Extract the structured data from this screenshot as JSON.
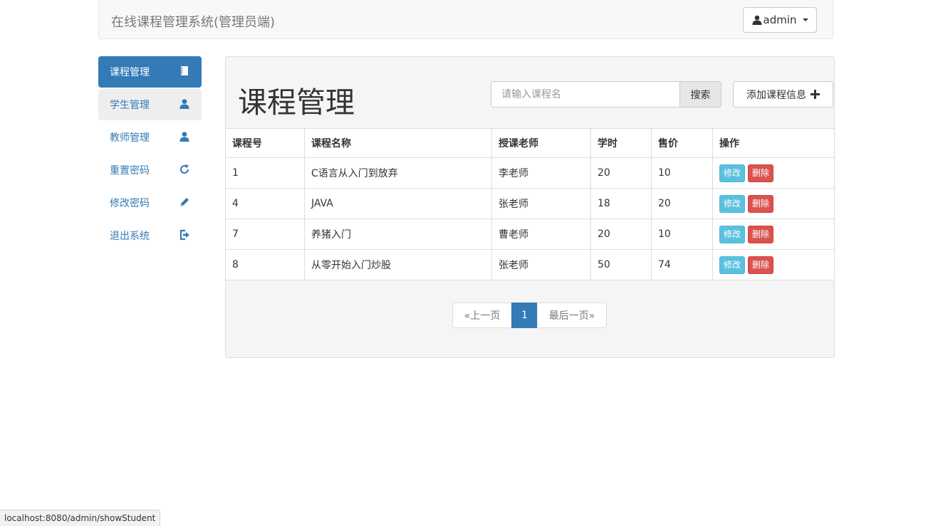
{
  "navbar": {
    "brand": "在线课程管理系统(管理员端)",
    "user": "admin"
  },
  "sidebar": {
    "items": [
      {
        "label": "课程管理",
        "icon": "book-icon",
        "state": "active"
      },
      {
        "label": "学生管理",
        "icon": "user-icon",
        "state": "hover"
      },
      {
        "label": "教师管理",
        "icon": "user-icon",
        "state": "normal"
      },
      {
        "label": "重置密码",
        "icon": "refresh-icon",
        "state": "normal"
      },
      {
        "label": "修改密码",
        "icon": "pencil-icon",
        "state": "normal"
      },
      {
        "label": "退出系统",
        "icon": "logout-icon",
        "state": "normal"
      }
    ]
  },
  "main": {
    "title": "课程管理",
    "search": {
      "placeholder": "请输入课程名",
      "button": "搜索"
    },
    "add_button": "添加课程信息",
    "table": {
      "headers": [
        "课程号",
        "课程名称",
        "授课老师",
        "学时",
        "售价",
        "操作"
      ],
      "rows": [
        {
          "id": "1",
          "name": "C语言从入门到放弃",
          "teacher": "李老师",
          "hours": "20",
          "price": "10"
        },
        {
          "id": "4",
          "name": "JAVA",
          "teacher": "张老师",
          "hours": "18",
          "price": "20"
        },
        {
          "id": "7",
          "name": "养猪入门",
          "teacher": "曹老师",
          "hours": "20",
          "price": "10"
        },
        {
          "id": "8",
          "name": "从零开始入门炒股",
          "teacher": "张老师",
          "hours": "50",
          "price": "74"
        }
      ],
      "edit_label": "修改",
      "delete_label": "删除"
    },
    "pagination": {
      "prev": "«上一页",
      "current": "1",
      "last": "最后一页»"
    }
  },
  "status_bar": {
    "url": "localhost:8080/admin/showStudent"
  },
  "colors": {
    "primary": "#337ab7",
    "info": "#5bc0de",
    "danger": "#d9534f"
  }
}
